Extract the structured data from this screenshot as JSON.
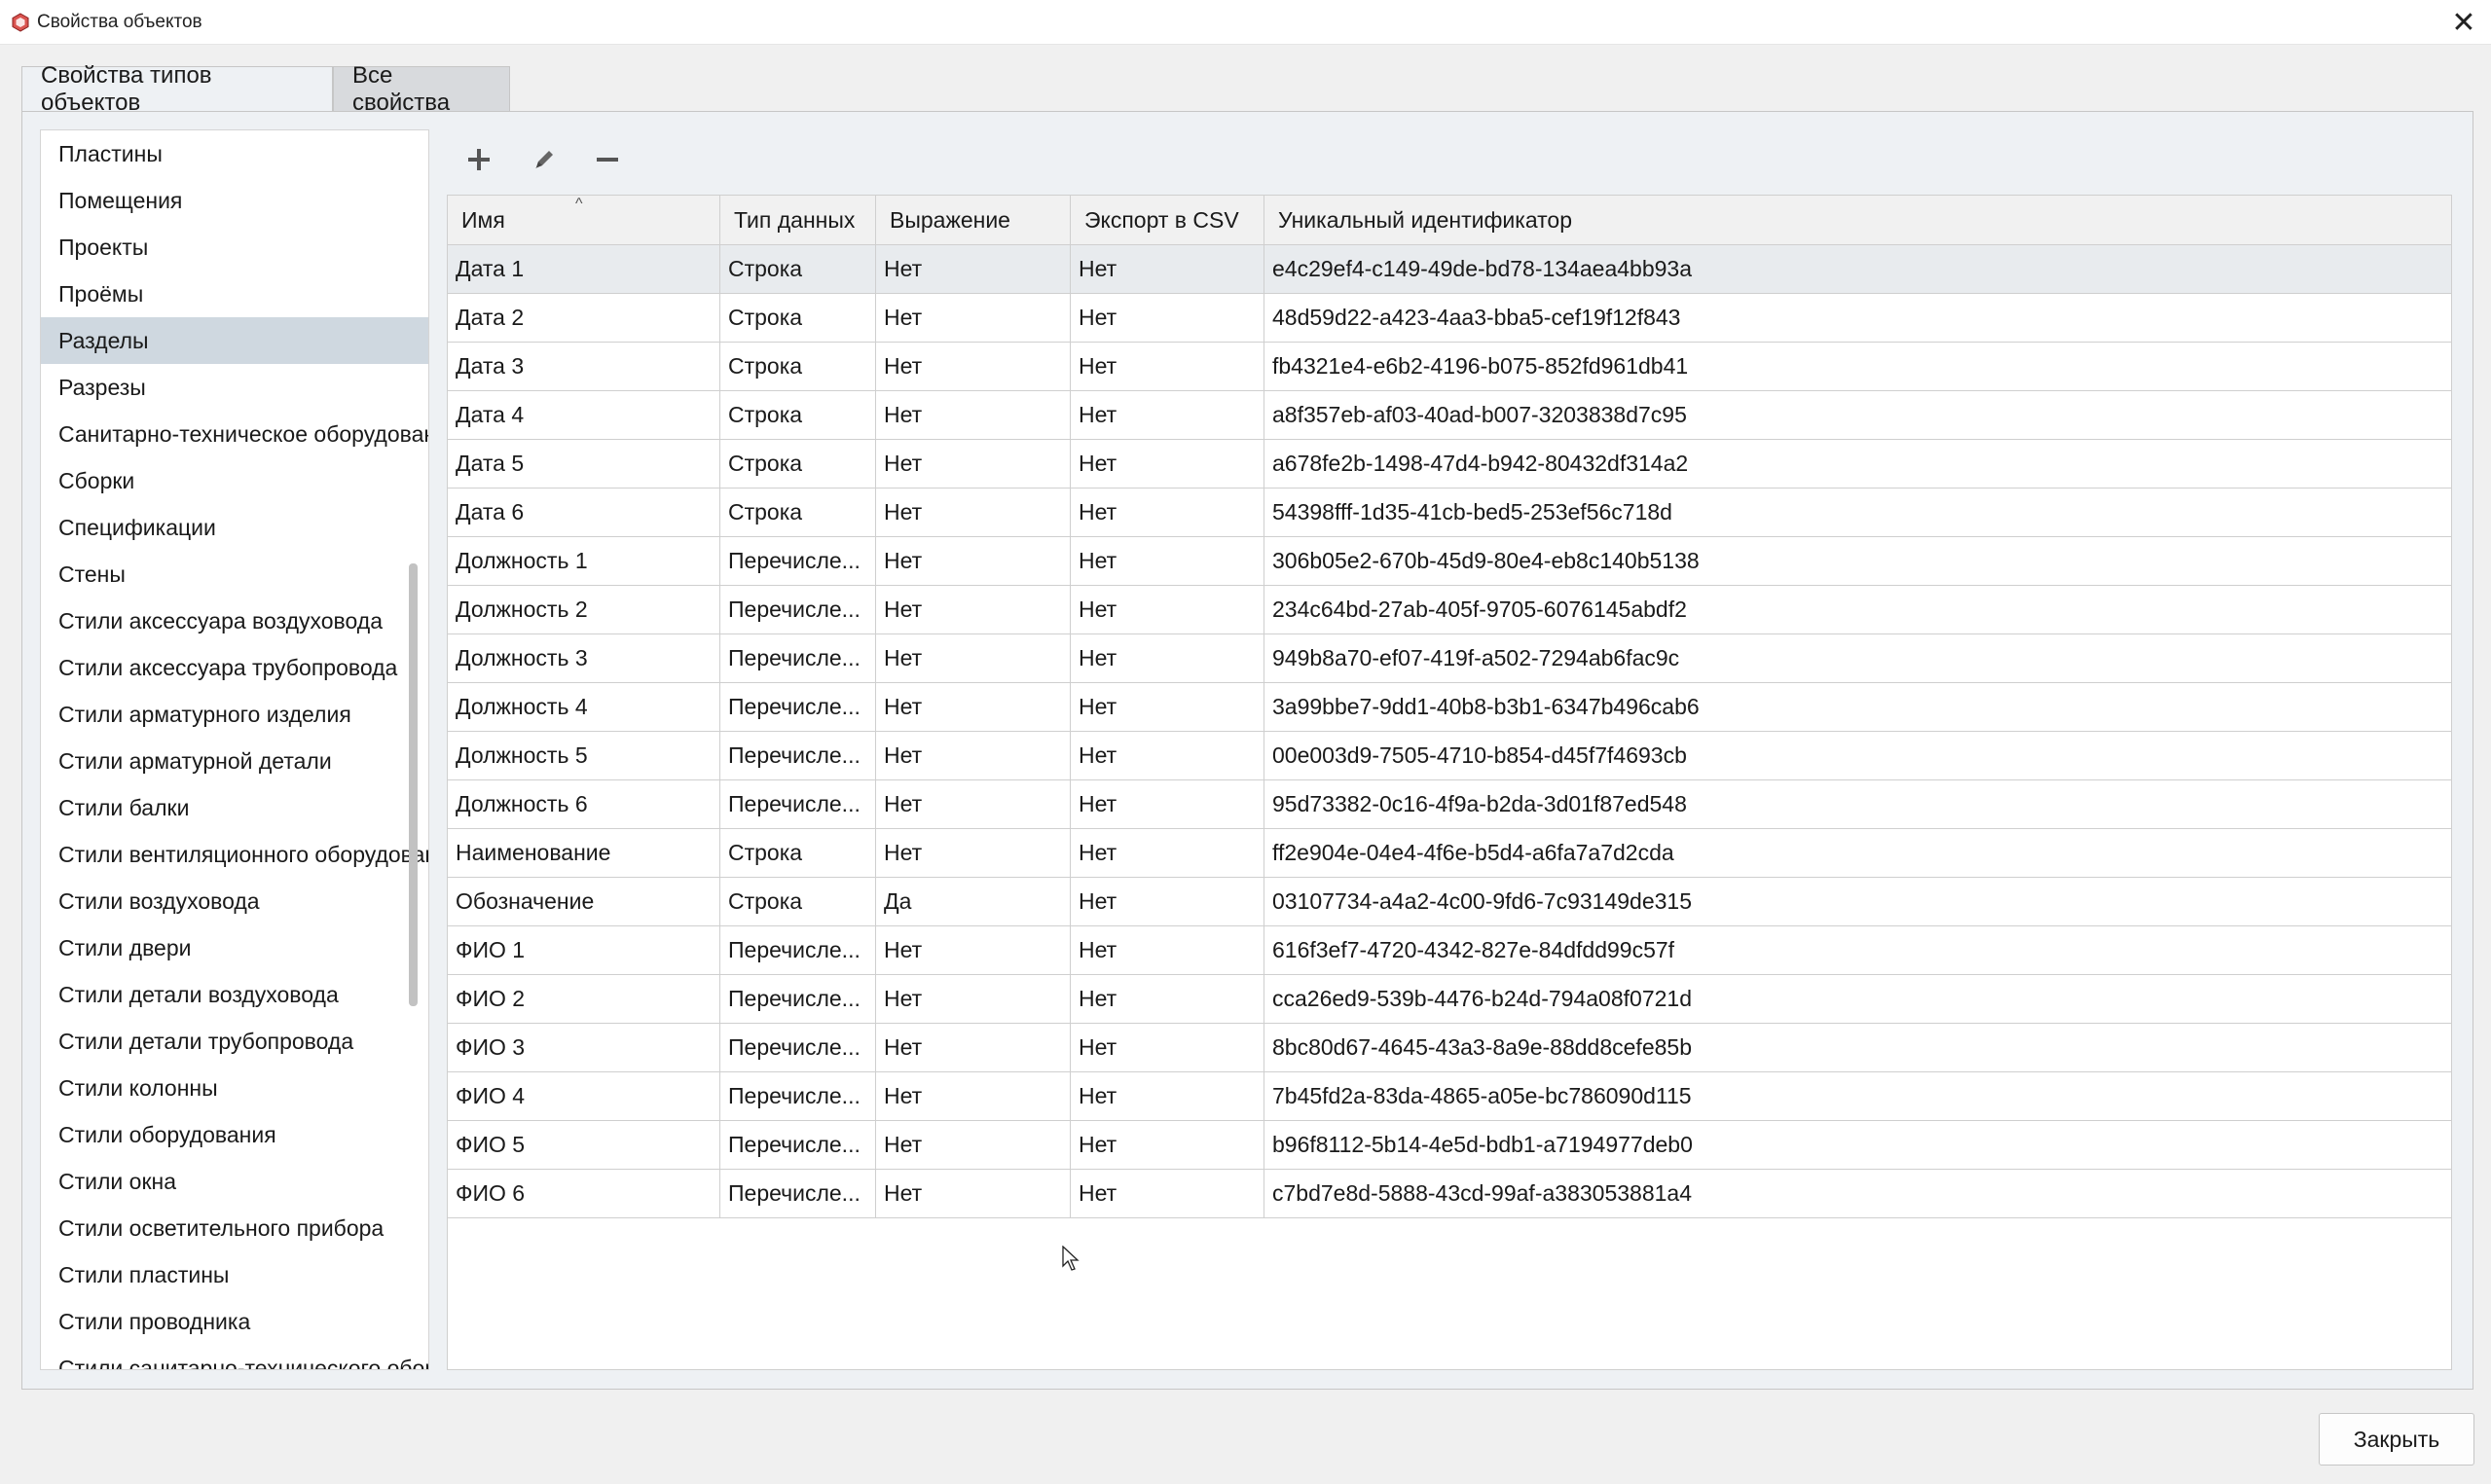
{
  "window": {
    "title": "Свойства объектов",
    "close_glyph": "✕"
  },
  "tabs": [
    {
      "label": "Свойства типов объектов",
      "active": true
    },
    {
      "label": "Все свойства",
      "active": false
    }
  ],
  "object_types": [
    "Пластины",
    "Помещения",
    "Проекты",
    "Проёмы",
    "Разделы",
    "Разрезы",
    "Санитарно-техническое оборудование",
    "Сборки",
    "Спецификации",
    "Стены",
    "Стили аксессуара воздуховода",
    "Стили аксессуара трубопровода",
    "Стили арматурного изделия",
    "Стили арматурной детали",
    "Стили балки",
    "Стили вентиляционного оборудования",
    "Стили воздуховода",
    "Стили двери",
    "Стили детали воздуховода",
    "Стили детали трубопровода",
    "Стили колонны",
    "Стили оборудования",
    "Стили окна",
    "Стили осветительного прибора",
    "Стили пластины",
    "Стили проводника",
    "Стили санитарно-технического оборудования"
  ],
  "selected_type": "Разделы",
  "toolbar": {
    "add_icon": "plus-icon",
    "edit_icon": "pencil-icon",
    "remove_icon": "minus-icon"
  },
  "grid": {
    "columns": [
      "Имя",
      "Тип данных",
      "Выражение",
      "Экспорт в CSV",
      "Уникальный идентификатор"
    ],
    "sort_indicator": "^",
    "rows": [
      [
        "Дата 1",
        "Строка",
        "Нет",
        "Нет",
        "e4c29ef4-c149-49de-bd78-134aea4bb93a"
      ],
      [
        "Дата 2",
        "Строка",
        "Нет",
        "Нет",
        "48d59d22-a423-4aa3-bba5-cef19f12f843"
      ],
      [
        "Дата 3",
        "Строка",
        "Нет",
        "Нет",
        "fb4321e4-e6b2-4196-b075-852fd961db41"
      ],
      [
        "Дата 4",
        "Строка",
        "Нет",
        "Нет",
        "a8f357eb-af03-40ad-b007-3203838d7c95"
      ],
      [
        "Дата 5",
        "Строка",
        "Нет",
        "Нет",
        "a678fe2b-1498-47d4-b942-80432df314a2"
      ],
      [
        "Дата 6",
        "Строка",
        "Нет",
        "Нет",
        "54398fff-1d35-41cb-bed5-253ef56c718d"
      ],
      [
        "Должность 1",
        "Перечисле...",
        "Нет",
        "Нет",
        "306b05e2-670b-45d9-80e4-eb8c140b5138"
      ],
      [
        "Должность 2",
        "Перечисле...",
        "Нет",
        "Нет",
        "234c64bd-27ab-405f-9705-6076145abdf2"
      ],
      [
        "Должность 3",
        "Перечисле...",
        "Нет",
        "Нет",
        "949b8a70-ef07-419f-a502-7294ab6fac9c"
      ],
      [
        "Должность 4",
        "Перечисле...",
        "Нет",
        "Нет",
        "3a99bbe7-9dd1-40b8-b3b1-6347b496cab6"
      ],
      [
        "Должность 5",
        "Перечисле...",
        "Нет",
        "Нет",
        "00e003d9-7505-4710-b854-d45f7f4693cb"
      ],
      [
        "Должность 6",
        "Перечисле...",
        "Нет",
        "Нет",
        "95d73382-0c16-4f9a-b2da-3d01f87ed548"
      ],
      [
        "Наименование",
        "Строка",
        "Нет",
        "Нет",
        "ff2e904e-04e4-4f6e-b5d4-a6fa7a7d2cda"
      ],
      [
        "Обозначение",
        "Строка",
        "Да",
        "Нет",
        "03107734-a4a2-4c00-9fd6-7c93149de315"
      ],
      [
        "ФИО 1",
        "Перечисле...",
        "Нет",
        "Нет",
        "616f3ef7-4720-4342-827e-84dfdd99c57f"
      ],
      [
        "ФИО 2",
        "Перечисле...",
        "Нет",
        "Нет",
        "cca26ed9-539b-4476-b24d-794a08f0721d"
      ],
      [
        "ФИО 3",
        "Перечисле...",
        "Нет",
        "Нет",
        "8bc80d67-4645-43a3-8a9e-88dd8cefe85b"
      ],
      [
        "ФИО 4",
        "Перечисле...",
        "Нет",
        "Нет",
        "7b45fd2a-83da-4865-a05e-bc786090d115"
      ],
      [
        "ФИО 5",
        "Перечисле...",
        "Нет",
        "Нет",
        "b96f8112-5b14-4e5d-bdb1-a7194977deb0"
      ],
      [
        "ФИО 6",
        "Перечисле...",
        "Нет",
        "Нет",
        "c7bd7e8d-5888-43cd-99af-a383053881a4"
      ]
    ],
    "selected_row": 0
  },
  "footer": {
    "close_label": "Закрыть"
  }
}
